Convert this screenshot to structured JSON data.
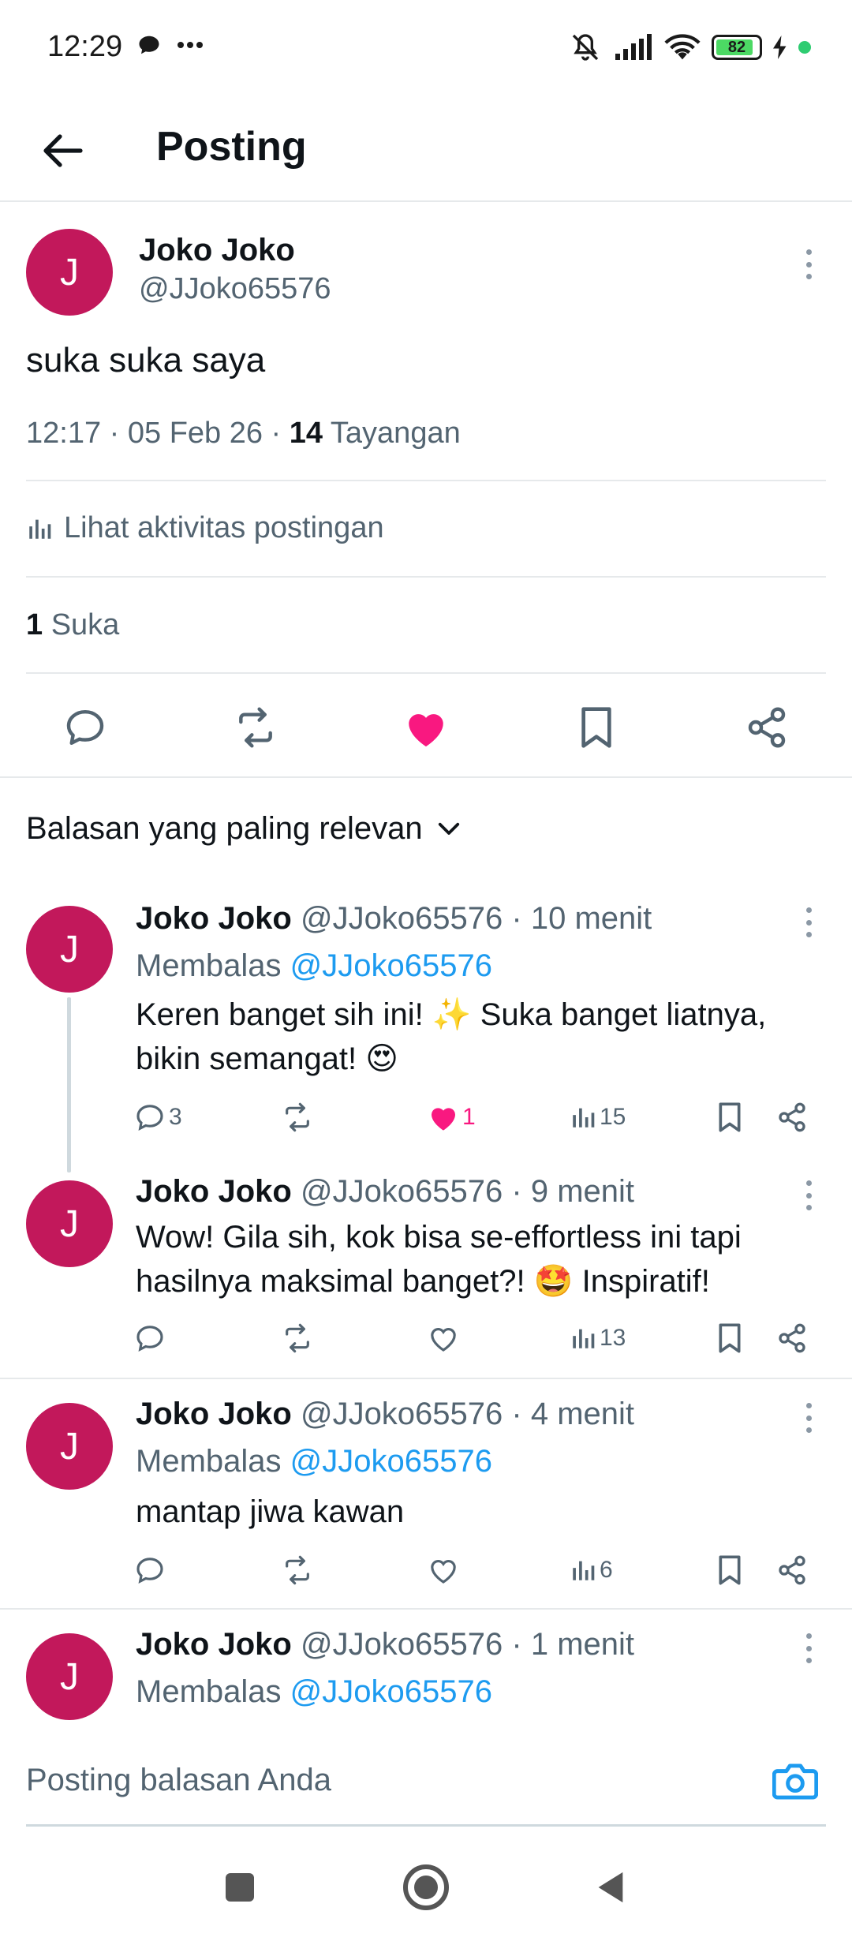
{
  "status_bar": {
    "time": "12:29",
    "battery": "82"
  },
  "header": {
    "title": "Posting"
  },
  "post": {
    "avatar_letter": "J",
    "name": "Joko Joko",
    "handle": "@JJoko65576",
    "text": "suka suka saya",
    "time_date": "12:17 · 05 Feb 26 · ",
    "views_count": "14",
    "views_label": " Tayangan",
    "activity_label": "Lihat aktivitas postingan",
    "likes_count": "1",
    "likes_label": " Suka"
  },
  "sort": {
    "label": "Balasan yang paling relevan"
  },
  "replies": [
    {
      "avatar_letter": "J",
      "name": "Joko Joko",
      "handle_time": " @JJoko65576 · 10 menit",
      "reply_prefix": "Membalas ",
      "reply_to": "@JJoko65576",
      "text_line1": "Keren banget sih ini! ✨ Suka banget liatnya,",
      "text_line2": "bikin semangat! 😍",
      "replies": "3",
      "retweets": "",
      "likes": "1",
      "views": "15"
    },
    {
      "avatar_letter": "J",
      "name": "Joko Joko",
      "handle_time": " @JJoko65576 · 9 menit",
      "text_line1": "Wow! Gila sih, kok bisa se-effortless ini tapi",
      "text_line2": "hasilnya maksimal banget?! 🤩 Inspiratif!",
      "replies": "",
      "retweets": "",
      "likes": "",
      "views": "13"
    },
    {
      "avatar_letter": "J",
      "name": "Joko Joko",
      "handle_time": " @JJoko65576 · 4 menit",
      "reply_prefix": "Membalas ",
      "reply_to": "@JJoko65576",
      "text_line1": "mantap jiwa kawan",
      "replies": "",
      "retweets": "",
      "likes": "",
      "views": "6"
    },
    {
      "avatar_letter": "J",
      "name": "Joko Joko",
      "handle_time": " @JJoko65576 · 1 menit",
      "reply_prefix": "Membalas ",
      "reply_to": "@JJoko65576"
    }
  ],
  "composer": {
    "placeholder": "Posting balasan Anda"
  },
  "icons": {
    "back": "back-arrow-icon",
    "more": "kebab-icon",
    "reply": "comment-icon",
    "retweet": "repost-icon",
    "like": "heart-icon",
    "bookmark": "bookmark-icon",
    "share": "share-icon",
    "views": "bar-chart-icon",
    "camera": "camera-icon"
  },
  "colors": {
    "avatar": "#c2185b",
    "like_active": "#f91880",
    "link": "#1d9bf0",
    "muted": "#536471"
  }
}
